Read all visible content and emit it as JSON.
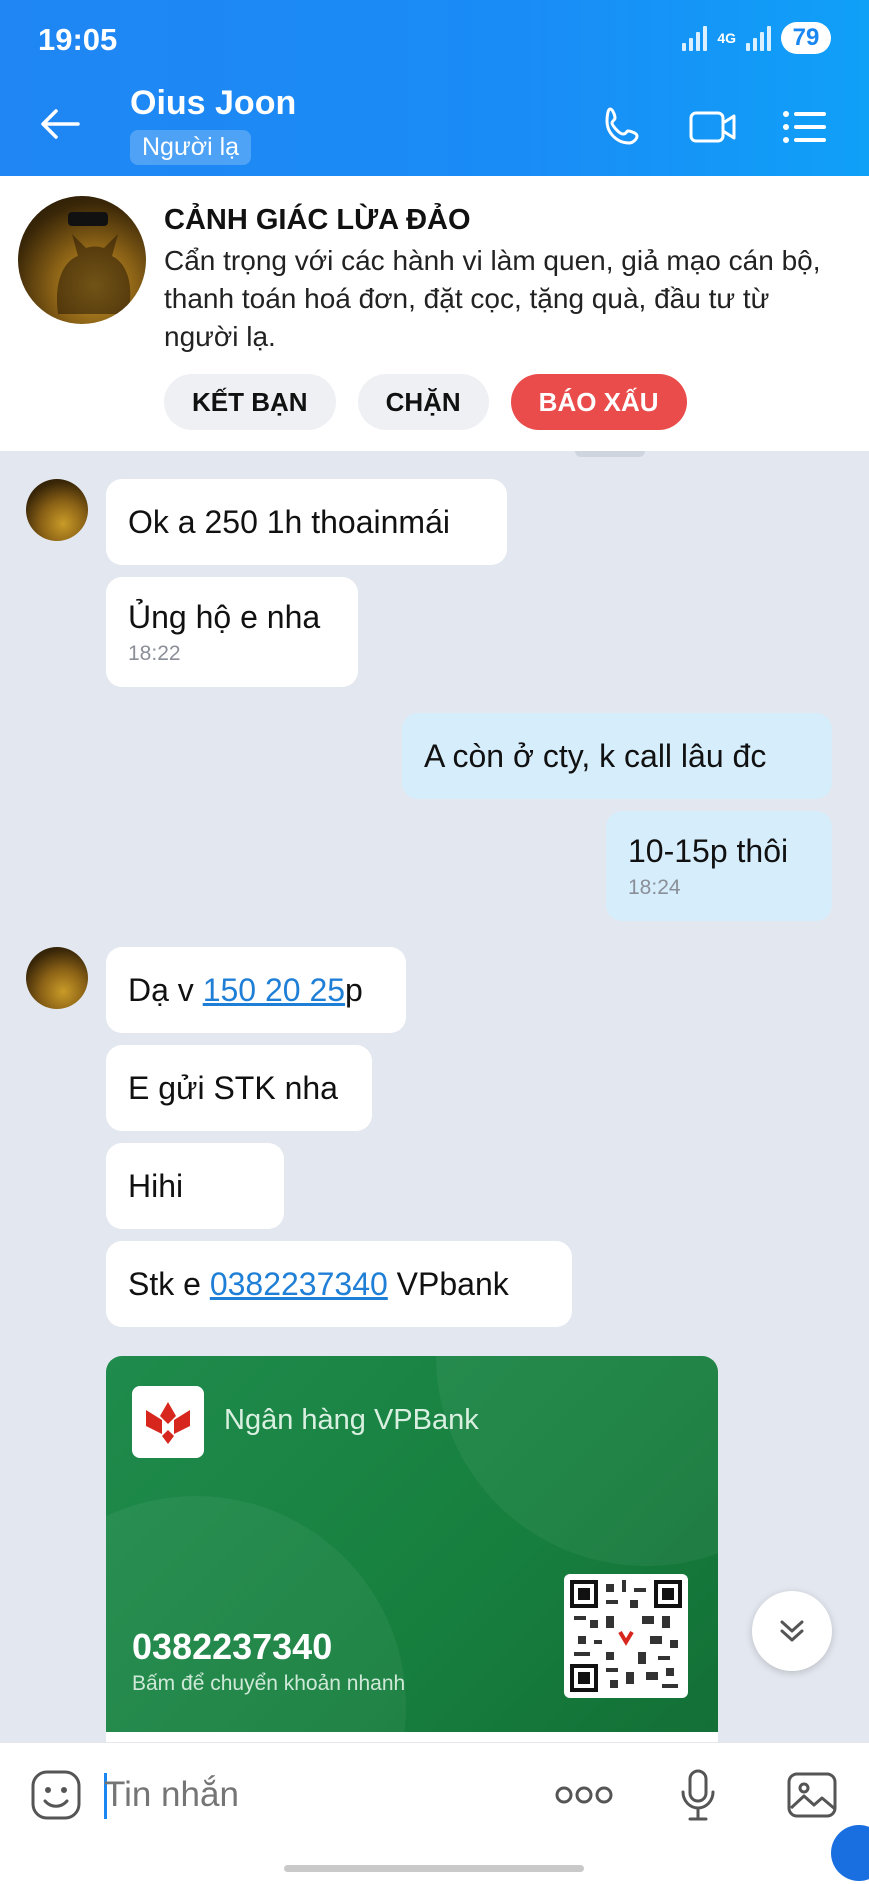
{
  "status": {
    "time": "19:05",
    "network": "4G",
    "battery": "79"
  },
  "header": {
    "name": "Oius Joon",
    "tag": "Người lạ"
  },
  "warning": {
    "title": "CẢNH GIÁC LỪA ĐẢO",
    "text": "Cẩn trọng với các hành vi làm quen, giả mạo cán bộ, thanh toán hoá đơn, đặt cọc, tặng quà, đầu tư từ người lạ.",
    "buttons": {
      "friend": "KẾT BẠN",
      "block": "CHẶN",
      "report": "BÁO XẤU"
    }
  },
  "messages": [
    {
      "from": "them",
      "text": "Ok a 250 1h thoainmái"
    },
    {
      "from": "them",
      "text": "Ủng hộ e nha",
      "time": "18:22"
    },
    {
      "from": "me",
      "text": "A còn ở cty, k call lâu đc"
    },
    {
      "from": "me",
      "text": "10-15p thôi",
      "time": "18:24"
    },
    {
      "from": "them",
      "prefix": "Dạ v ",
      "link": "150 20 25",
      "suffix": "p"
    },
    {
      "from": "them",
      "text": "E gửi STK nha"
    },
    {
      "from": "them",
      "text": "Hihi"
    },
    {
      "from": "them",
      "prefix": "Stk e ",
      "link": "0382237340",
      "suffix": " VPbank"
    }
  ],
  "bank_card": {
    "bank_name": "Ngân hàng VPBank",
    "account": "0382237340",
    "hint": "Bấm để chuyển khoản nhanh",
    "color": "#1b8446"
  },
  "input": {
    "placeholder": "Tin nhắn"
  },
  "colors": {
    "accent": "#1a86f2",
    "report": "#ea4b4b",
    "link": "#1f7fd6"
  }
}
